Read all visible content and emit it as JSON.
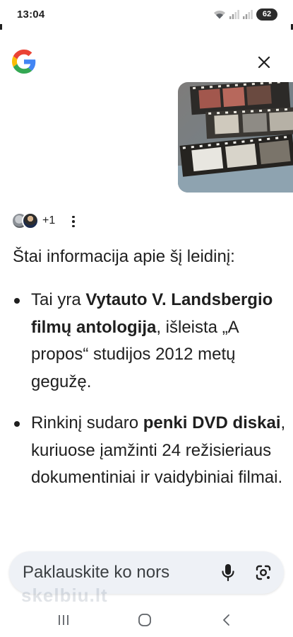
{
  "status_bar": {
    "time": "13:04",
    "battery": "62",
    "icons": [
      "wifi-icon",
      "signal-icon",
      "signal-icon",
      "battery-icon"
    ]
  },
  "header": {
    "logo": "google-logo",
    "close_icon": "close-icon"
  },
  "meta": {
    "extra_sources": "+1",
    "more_icon": "more-vert-icon"
  },
  "answer": {
    "intro": "Štai informacija apie šį leidinį:",
    "bullets": [
      {
        "pre": "Tai yra ",
        "bold": "Vytauto V. Landsbergio filmų antologija",
        "post": ", išleista „A propos“ studijos 2012 metų gegužę."
      },
      {
        "pre": "Rinkinį sudaro ",
        "bold": "penki DVD diskai",
        "post": ", kuriuose įamžinti 24 režisieriaus dokumentiniai ir vaidybiniai filmai."
      }
    ]
  },
  "input": {
    "placeholder": "Paklauskite ko nors",
    "value": "",
    "mic_icon": "mic-icon",
    "lens_icon": "google-lens-icon"
  },
  "watermark": "skelbiu.lt",
  "colors": {
    "text": "#1f1f1f",
    "input_bg": "#eef1f6",
    "google_blue": "#4285F4",
    "google_red": "#EA4335",
    "google_yellow": "#FBBC05",
    "google_green": "#34A853"
  },
  "nav": {
    "recents_icon": "recents-icon",
    "home_icon": "home-icon",
    "back_icon": "back-icon"
  }
}
